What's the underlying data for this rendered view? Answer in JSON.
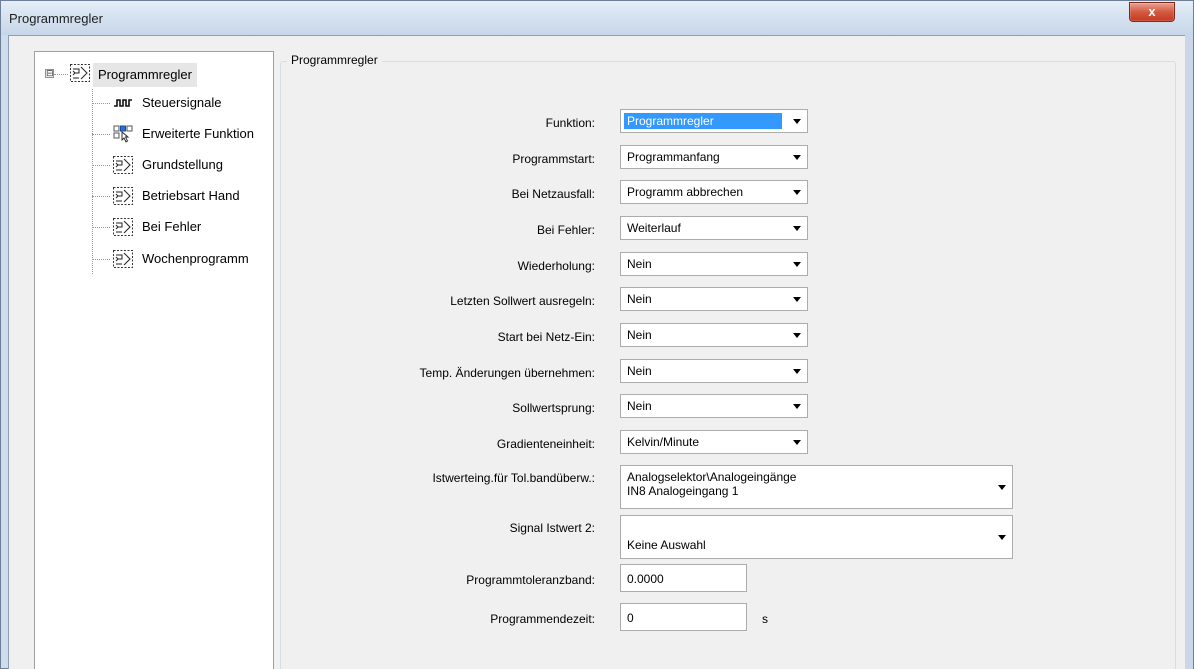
{
  "window": {
    "title": "Programmregler",
    "close_label": "x"
  },
  "tree": {
    "root_expander": "⊟",
    "root": {
      "label": "Programmregler",
      "icon": "program-controller-icon"
    },
    "children": [
      {
        "label": "Steuersignale",
        "icon": "pulse-signal-icon"
      },
      {
        "label": "Erweiterte Funktion",
        "icon": "extended-functions-icon"
      },
      {
        "label": "Grundstellung",
        "icon": "program-controller-icon"
      },
      {
        "label": "Betriebsart Hand",
        "icon": "program-controller-icon"
      },
      {
        "label": "Bei Fehler",
        "icon": "program-controller-icon"
      },
      {
        "label": "Wochenprogramm",
        "icon": "program-controller-icon"
      }
    ]
  },
  "form": {
    "group_title": "Programmregler",
    "rows": [
      {
        "label": "Funktion:",
        "value": "Programmregler"
      },
      {
        "label": "Programmstart:",
        "value": "Programmanfang"
      },
      {
        "label": "Bei Netzausfall:",
        "value": "Programm abbrechen"
      },
      {
        "label": "Bei Fehler:",
        "value": "Weiterlauf"
      },
      {
        "label": "Wiederholung:",
        "value": "Nein"
      },
      {
        "label": "Letzten Sollwert ausregeln:",
        "value": "Nein"
      },
      {
        "label": "Start bei Netz-Ein:",
        "value": "Nein"
      },
      {
        "label": "Temp. Änderungen übernehmen:",
        "value": "Nein"
      },
      {
        "label": "Sollwertsprung:",
        "value": "Nein"
      },
      {
        "label": "Gradienteneinheit:",
        "value": "Kelvin/Minute"
      }
    ],
    "istwert": {
      "label": "Istwerteing.für Tol.bandüberw.:",
      "value_line1": "Analogselektor\\Analogeingänge",
      "value_line2": "IN8 Analogeingang 1"
    },
    "signal2": {
      "label": "Signal Istwert 2:",
      "value": "Keine Auswahl"
    },
    "toleranzband": {
      "label": "Programmtoleranzband:",
      "value": "0.0000"
    },
    "endezeit": {
      "label": "Programmendezeit:",
      "value": "0",
      "unit": "s"
    }
  }
}
